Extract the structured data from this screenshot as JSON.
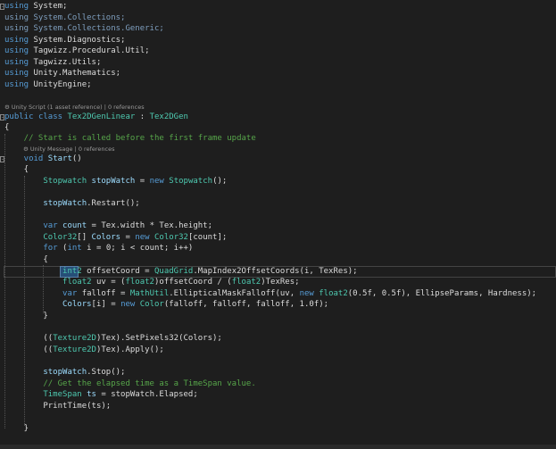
{
  "lens": {
    "class_lens": "⚙ Unity Script (1 asset reference) | 0 references",
    "method_lens": "⚙ Unity Message | 0 references"
  },
  "code_lines": [
    [
      [
        "using ",
        "kw"
      ],
      [
        "System;",
        "tx"
      ]
    ],
    [
      [
        "using ",
        "dim"
      ],
      [
        "System.Collections;",
        "dim"
      ]
    ],
    [
      [
        "using ",
        "dim"
      ],
      [
        "System.Collections.Generic;",
        "dim"
      ]
    ],
    [
      [
        "using ",
        "kw"
      ],
      [
        "System.Diagnostics;",
        "tx"
      ]
    ],
    [
      [
        "using ",
        "kw"
      ],
      [
        "Tagwizz.Procedural.Util;",
        "tx"
      ]
    ],
    [
      [
        "using ",
        "kw"
      ],
      [
        "Tagwizz.Utils;",
        "tx"
      ]
    ],
    [
      [
        "using ",
        "kw"
      ],
      [
        "Unity.Mathematics;",
        "tx"
      ]
    ],
    [
      [
        "using ",
        "kw"
      ],
      [
        "UnityEngine;",
        "tx"
      ]
    ],
    [
      [
        "public ",
        "kw"
      ],
      [
        "class ",
        "kw"
      ],
      [
        "Tex2DGenLinear",
        "ty"
      ],
      [
        " : ",
        "tx"
      ],
      [
        "Tex2DGen",
        "ty"
      ]
    ],
    [
      [
        "{",
        "tx"
      ]
    ],
    [
      [
        "    // Start is called before the first frame update",
        "cm"
      ]
    ],
    [
      [
        "    void ",
        "kw"
      ],
      [
        "Start",
        "id"
      ],
      [
        "()",
        "tx"
      ]
    ],
    [
      [
        "    {",
        "tx"
      ]
    ],
    [
      [
        "        Stopwatch ",
        "ty"
      ],
      [
        "stopWatch",
        "id"
      ],
      [
        " = ",
        "tx"
      ],
      [
        "new ",
        "kw"
      ],
      [
        "Stopwatch",
        "ty"
      ],
      [
        "();",
        "tx"
      ]
    ],
    [
      [
        "        stopWatch",
        "id"
      ],
      [
        ".Restart();",
        "tx"
      ]
    ],
    [
      [
        "        var ",
        "kw"
      ],
      [
        "count",
        "id"
      ],
      [
        " = Tex.width * Tex.height;",
        "tx"
      ]
    ],
    [
      [
        "        Color32",
        "ty"
      ],
      [
        "[] ",
        "tx"
      ],
      [
        "Colors",
        "id"
      ],
      [
        " = ",
        "tx"
      ],
      [
        "new ",
        "kw"
      ],
      [
        "Color32",
        "ty"
      ],
      [
        "[count];",
        "tx"
      ]
    ],
    [
      [
        "        for ",
        "kw"
      ],
      [
        "(",
        "tx"
      ],
      [
        "int ",
        "kw"
      ],
      [
        "i = 0; i < count; i++)",
        "tx"
      ]
    ],
    [
      [
        "        {",
        "tx"
      ]
    ],
    [
      [
        "            int2",
        "ty"
      ],
      [
        " offsetCoord = ",
        "tx"
      ],
      [
        "QuadGrid",
        "ty"
      ],
      [
        ".MapIndex2OffsetCoords(i, TexRes);",
        "tx"
      ]
    ],
    [
      [
        "            float2 ",
        "ty"
      ],
      [
        "uv = (",
        "tx"
      ],
      [
        "float2",
        "ty"
      ],
      [
        ")offsetCoord / (",
        "tx"
      ],
      [
        "float2",
        "ty"
      ],
      [
        ")TexRes;",
        "tx"
      ]
    ],
    [
      [
        "            var ",
        "kw"
      ],
      [
        "falloff = ",
        "tx"
      ],
      [
        "MathUtil",
        "ty"
      ],
      [
        ".EllipticalMaskFalloff(uv, ",
        "tx"
      ],
      [
        "new ",
        "kw"
      ],
      [
        "float2",
        "ty"
      ],
      [
        "(0.5f, 0.5f), EllipseParams, Hardness);",
        "tx"
      ]
    ],
    [
      [
        "            Colors",
        "id"
      ],
      [
        "[i] = ",
        "tx"
      ],
      [
        "new ",
        "kw"
      ],
      [
        "Color",
        "ty"
      ],
      [
        "(falloff, falloff, falloff, 1.0f);",
        "tx"
      ]
    ],
    [
      [
        "        }",
        "tx"
      ]
    ],
    [
      [
        "        ((",
        "tx"
      ],
      [
        "Texture2D",
        "ty"
      ],
      [
        ")Tex).SetPixels32(Colors);",
        "tx"
      ]
    ],
    [
      [
        "        ((",
        "tx"
      ],
      [
        "Texture2D",
        "ty"
      ],
      [
        ")Tex).Apply();",
        "tx"
      ]
    ],
    [
      [
        "        stopWatch",
        "id"
      ],
      [
        ".Stop();",
        "tx"
      ]
    ],
    [
      [
        "        // Get the elapsed time as a TimeSpan value.",
        "cm"
      ]
    ],
    [
      [
        "        TimeSpan ",
        "ty"
      ],
      [
        "ts",
        "id"
      ],
      [
        " = stopWatch.Elapsed;",
        "tx"
      ]
    ],
    [
      [
        "        PrintTime(ts);",
        "tx"
      ]
    ],
    [
      [
        "    }",
        "tx"
      ]
    ]
  ]
}
